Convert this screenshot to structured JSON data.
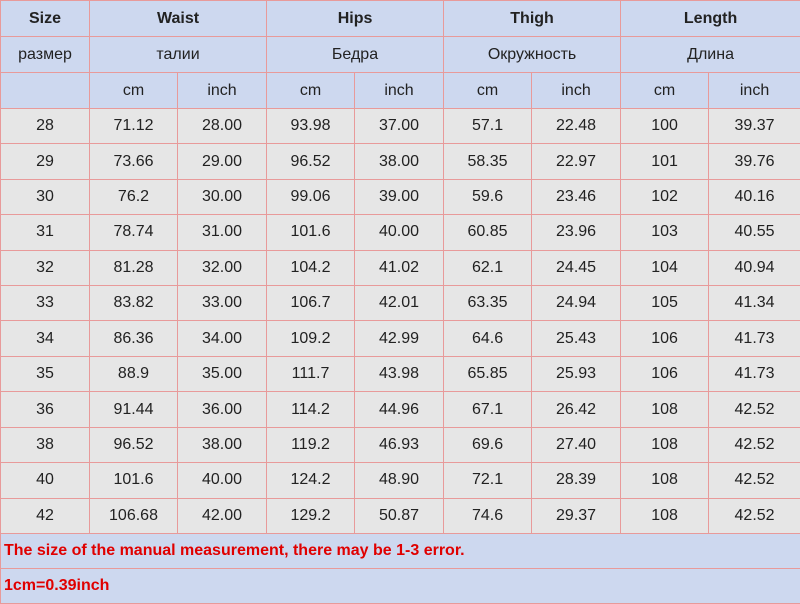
{
  "header": {
    "groups": [
      "Size",
      "Waist",
      "Hips",
      "Thigh",
      "Length"
    ],
    "subgroups": [
      "размер",
      "талии",
      "Бедра",
      "Окружность",
      "Длина"
    ],
    "units": [
      "cm",
      "inch",
      "cm",
      "inch",
      "cm",
      "inch",
      "cm",
      "inch"
    ]
  },
  "rows": [
    [
      "28",
      "71.12",
      "28.00",
      "93.98",
      "37.00",
      "57.1",
      "22.48",
      "100",
      "39.37"
    ],
    [
      "29",
      "73.66",
      "29.00",
      "96.52",
      "38.00",
      "58.35",
      "22.97",
      "101",
      "39.76"
    ],
    [
      "30",
      "76.2",
      "30.00",
      "99.06",
      "39.00",
      "59.6",
      "23.46",
      "102",
      "40.16"
    ],
    [
      "31",
      "78.74",
      "31.00",
      "101.6",
      "40.00",
      "60.85",
      "23.96",
      "103",
      "40.55"
    ],
    [
      "32",
      "81.28",
      "32.00",
      "104.2",
      "41.02",
      "62.1",
      "24.45",
      "104",
      "40.94"
    ],
    [
      "33",
      "83.82",
      "33.00",
      "106.7",
      "42.01",
      "63.35",
      "24.94",
      "105",
      "41.34"
    ],
    [
      "34",
      "86.36",
      "34.00",
      "109.2",
      "42.99",
      "64.6",
      "25.43",
      "106",
      "41.73"
    ],
    [
      "35",
      "88.9",
      "35.00",
      "111.7",
      "43.98",
      "65.85",
      "25.93",
      "106",
      "41.73"
    ],
    [
      "36",
      "91.44",
      "36.00",
      "114.2",
      "44.96",
      "67.1",
      "26.42",
      "108",
      "42.52"
    ],
    [
      "38",
      "96.52",
      "38.00",
      "119.2",
      "46.93",
      "69.6",
      "27.40",
      "108",
      "42.52"
    ],
    [
      "40",
      "101.6",
      "40.00",
      "124.2",
      "48.90",
      "72.1",
      "28.39",
      "108",
      "42.52"
    ],
    [
      "42",
      "106.68",
      "42.00",
      "129.2",
      "50.87",
      "74.6",
      "29.37",
      "108",
      "42.52"
    ]
  ],
  "notes": {
    "error": "The size of the manual measurement, there may be 1-3 error.",
    "conversion": "1cm=0.39inch"
  },
  "colors": {
    "header_bg": "#cdd8ef",
    "row_bg": "#e6e6e6",
    "border": "#e89a9a",
    "note_text": "#e00000"
  }
}
